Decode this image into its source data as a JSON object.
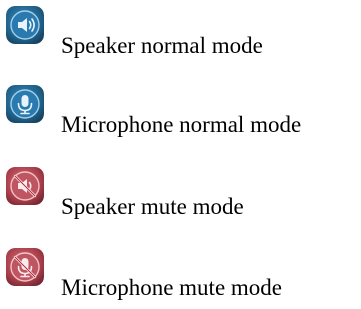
{
  "legend": {
    "items": [
      {
        "icon": "speaker-normal-icon",
        "label": "Speaker normal mode",
        "state_color": "#2b6f9a"
      },
      {
        "icon": "microphone-normal-icon",
        "label": "Microphone normal mode",
        "state_color": "#2b6f9a"
      },
      {
        "icon": "speaker-mute-icon",
        "label": "Speaker mute mode",
        "state_color": "#b34a55"
      },
      {
        "icon": "microphone-mute-icon",
        "label": "Microphone mute mode",
        "state_color": "#b34a55"
      }
    ]
  }
}
